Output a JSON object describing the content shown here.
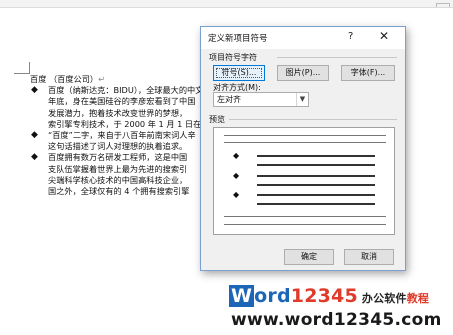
{
  "document": {
    "heading": "百度 （百度公司）",
    "pilcrow": "↵",
    "bullet_symbol": "◆",
    "paragraphs": [
      {
        "lines": [
          "百度（纳斯达克：BIDU），全球最大的中文",
          "年底，身在美国硅谷的李彦宏看到了中国",
          "发展潜力，抱着技术改变世界的梦想，",
          "索引擎专利技术，于 2000 年 1 月 1 日在"
        ]
      },
      {
        "lines": [
          "“百度”二字，来自于八百年前南宋词人辛",
          "这句话描述了词人对理想的执着追求。"
        ]
      },
      {
        "lines": [
          "百度拥有数万名研发工程师，这是中国",
          "支队伍掌握着世界上最为先进的搜索引",
          "尖端科学核心技术的中国高科技企业，",
          "国之外，全球仅有的 4 个拥有搜索引擎"
        ]
      }
    ]
  },
  "dialog": {
    "title": "定义新项目符号",
    "help_label": "?",
    "close_label": "✕",
    "group_char_label": "项目符号字符",
    "buttons": {
      "symbol": "符号(S)...",
      "picture": "图片(P)...",
      "font": "字体(F)..."
    },
    "align_label": "对齐方式(M):",
    "align_value": "左对齐",
    "preview_label": "预览",
    "ok_label": "确定",
    "cancel_label": "取消"
  },
  "watermark": {
    "logo_w": "W",
    "logo_ord": "ord",
    "logo_num": "12345",
    "logo_tail_a": "办公软件",
    "logo_tail_b": "教程",
    "url": "www.word12345.com"
  }
}
